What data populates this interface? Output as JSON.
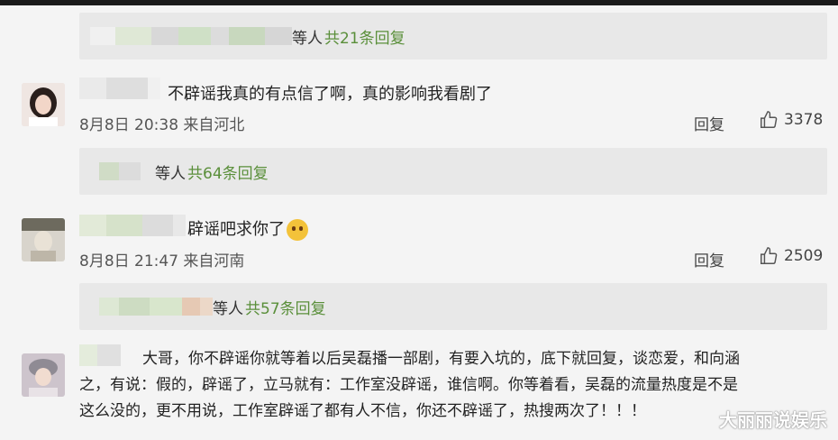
{
  "thread1": {
    "reply_suffix": "等人",
    "reply_count": "共21条回复"
  },
  "comment1": {
    "text": "不辟谣我真的有点信了啊，真的影响我看剧了",
    "date": "8月8日 20:38 来自河北",
    "reply_label": "回复",
    "likes": "3378",
    "sub": {
      "reply_suffix": "等人",
      "reply_count": "共64条回复"
    }
  },
  "comment2": {
    "text": "辟谣吧求你了",
    "emoji": "crying-face",
    "date": "8月8日 21:47 来自河南",
    "reply_label": "回复",
    "likes": "2509",
    "sub": {
      "reply_suffix": "等人",
      "reply_count": "共57条回复"
    }
  },
  "comment3": {
    "line1": "大哥，你不辟谣你就等着以后吴磊播一部剧，有要入坑的，底下就回复，谈恋爱，和向涵",
    "line2": "之，有说：假的，辟谣了，立马就有：工作室没辟谣，谁信啊。你等着看，吴磊的流量热度是不是",
    "line3": "这么没的，更不用说，工作室辟谣了都有人不信，你还不辟谣了，热搜两次了！！！"
  },
  "watermark": "大丽丽说娱乐",
  "colors": {
    "background": "#f4f4f4",
    "reply_box": "#e8e8e8",
    "reply_count": "#5a8f3a",
    "text": "#222222"
  }
}
